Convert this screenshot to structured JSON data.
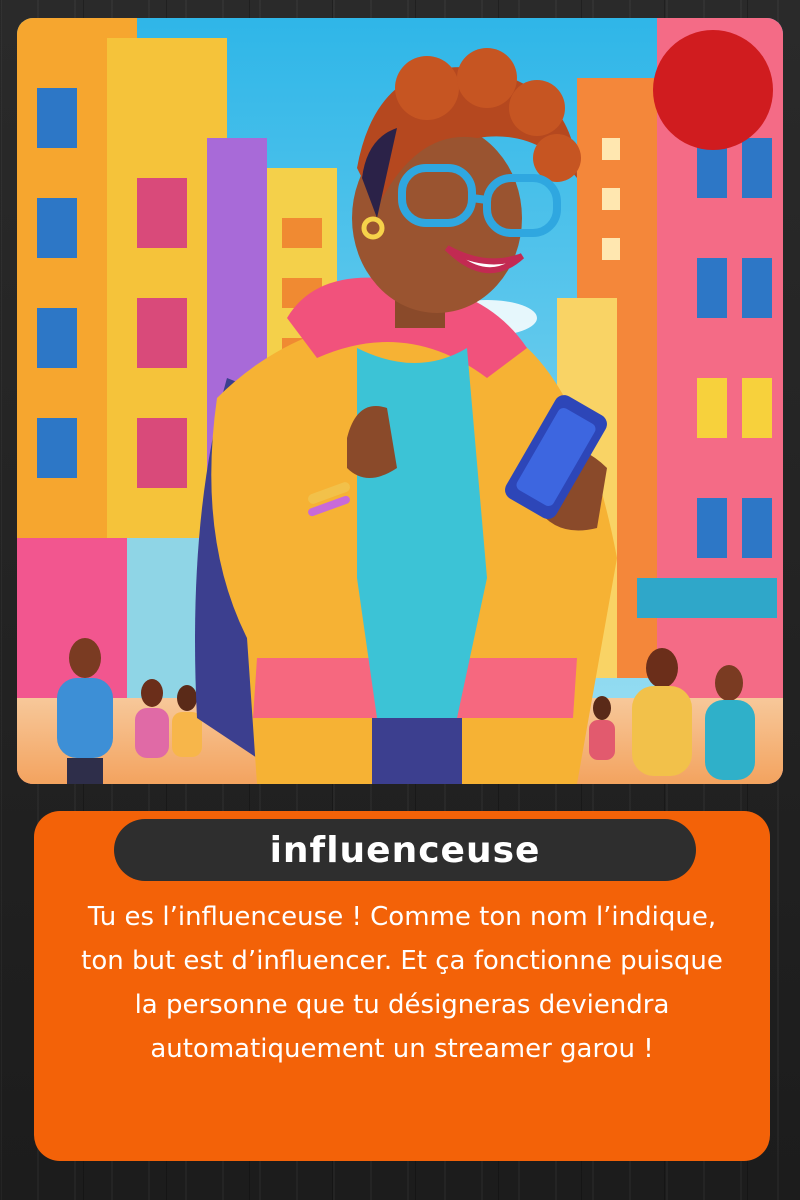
{
  "card": {
    "name": "influenceuse",
    "description": "Tu es l’influenceuse ! Comme ton nom l’indique, ton but est d’influencer. Et ça fonctionne puisque la personne que tu désigneras deviendra automatiquement un streamer garou !"
  },
  "illustration": {
    "subject": "woman-with-glasses-holding-phone-in-city",
    "corner_dot_color": "#d01c1f"
  }
}
